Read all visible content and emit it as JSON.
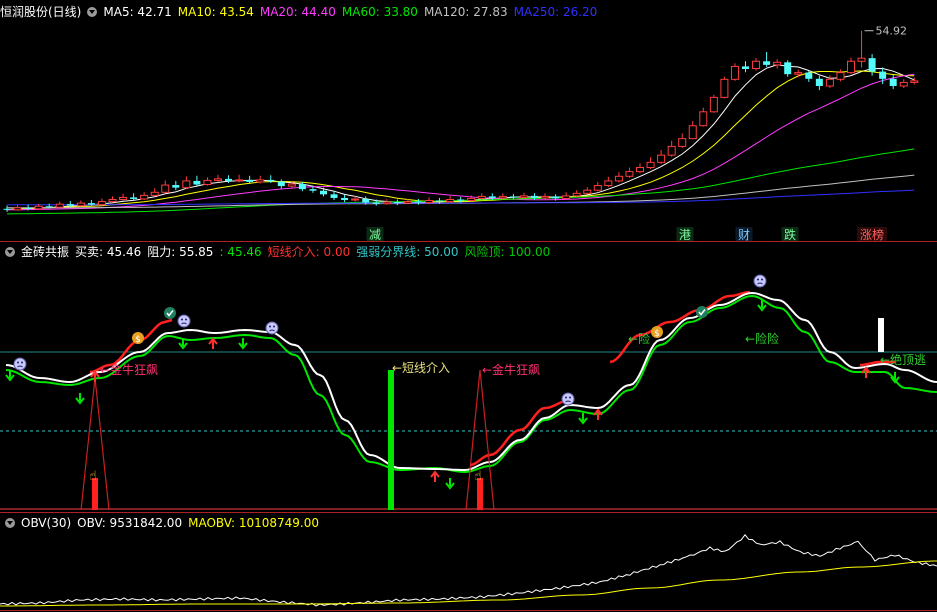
{
  "colors": {
    "bg": "#000000",
    "separator": "#b02020",
    "up_candle": "#ff3c3c",
    "down_candle": "#54fcfc",
    "ma5": "#ffffff",
    "ma10": "#ffff00",
    "ma20": "#ff3cff",
    "ma60": "#00e600",
    "ma120": "#c0c0c0",
    "ma250": "#3030ff",
    "obv": "#ffffff",
    "maobv": "#ffff00"
  },
  "panel1": {
    "title": "恒润股份(日线)",
    "legend": [
      {
        "label": "MA5: 42.71",
        "color": "#ffffff"
      },
      {
        "label": "MA10: 43.54",
        "color": "#ffff00"
      },
      {
        "label": "MA20: 44.40",
        "color": "#ff3cff"
      },
      {
        "label": "MA60: 33.80",
        "color": "#00e600"
      },
      {
        "label": "MA120: 27.83",
        "color": "#c0c0c0"
      },
      {
        "label": "MA250: 26.20",
        "color": "#3030ff"
      }
    ],
    "high_label": "54.92",
    "signal_tags": [
      {
        "text": "减",
        "color": "#7cfc9c"
      },
      {
        "text": "港",
        "color": "#7cfc9c"
      },
      {
        "text": "财",
        "color": "#7cc8ff"
      },
      {
        "text": "跌",
        "color": "#7cfc9c"
      },
      {
        "text": "涨榜",
        "color": "#ff6060"
      }
    ]
  },
  "panel2": {
    "title": "金砖共振",
    "legend": [
      {
        "label": "买卖: 45.46",
        "color": "#ffffff"
      },
      {
        "label": "阻力: 55.85",
        "color": "#ffffff"
      },
      {
        "label": ": 45.46",
        "color": "#00e600"
      },
      {
        "label": "短线介入: 0.00",
        "color": "#ff3030"
      },
      {
        "label": "强弱分界线: 50.00",
        "color": "#30c8c8"
      },
      {
        "label": "风险顶: 100.00",
        "color": "#00c800"
      }
    ],
    "annotations": {
      "bull_left": "←金牛狂飙",
      "short_entry": "←短线介入",
      "bull_right": "←金牛狂飙",
      "risk1": "←险",
      "risk2": "←险险",
      "top_escape": "←绝顶逃"
    }
  },
  "panel3": {
    "title": "OBV(30)",
    "legend": [
      {
        "label": "OBV: 9531842.00",
        "color": "#ffffff"
      },
      {
        "label": "MAOBV: 10108749.00",
        "color": "#ffff00"
      }
    ]
  },
  "chart_data": [
    {
      "type": "candlestick",
      "title": "恒润股份(日线)",
      "annotations": [
        "54.92"
      ],
      "series": [
        {
          "name": "MA5",
          "last": 42.71
        },
        {
          "name": "MA10",
          "last": 43.54
        },
        {
          "name": "MA20",
          "last": 44.4
        },
        {
          "name": "MA60",
          "last": 33.8
        },
        {
          "name": "MA120",
          "last": 27.83
        },
        {
          "name": "MA250",
          "last": 26.2
        }
      ],
      "candles": [
        [
          20.4,
          20.2,
          21.0,
          19.8
        ],
        [
          20.2,
          20.6,
          21.1,
          20.0
        ],
        [
          20.6,
          20.5,
          21.2,
          20.1
        ],
        [
          20.4,
          20.9,
          21.3,
          20.2
        ],
        [
          20.9,
          20.8,
          21.4,
          20.5
        ],
        [
          20.7,
          21.3,
          21.8,
          20.5
        ],
        [
          21.3,
          21.0,
          21.9,
          20.8
        ],
        [
          21.0,
          21.5,
          22.0,
          20.8
        ],
        [
          21.5,
          21.2,
          22.1,
          21.0
        ],
        [
          21.2,
          21.8,
          22.4,
          21.0
        ],
        [
          21.8,
          22.2,
          22.8,
          21.6
        ],
        [
          22.2,
          22.6,
          23.3,
          22.0
        ],
        [
          22.6,
          22.3,
          23.4,
          22.0
        ],
        [
          22.3,
          23.0,
          23.6,
          22.1
        ],
        [
          23.0,
          23.6,
          24.4,
          22.8
        ],
        [
          23.6,
          25.0,
          25.9,
          23.4
        ],
        [
          25.0,
          24.5,
          25.8,
          24.0
        ],
        [
          24.5,
          25.8,
          26.7,
          24.3
        ],
        [
          25.8,
          25.1,
          26.8,
          24.8
        ],
        [
          25.1,
          25.9,
          26.5,
          24.9
        ],
        [
          25.9,
          26.2,
          27.0,
          25.5
        ],
        [
          26.2,
          25.8,
          26.9,
          25.4
        ],
        [
          25.9,
          26.0,
          27.0,
          25.5
        ],
        [
          26.0,
          25.6,
          26.8,
          25.2
        ],
        [
          25.6,
          26.0,
          26.8,
          25.3
        ],
        [
          26.0,
          25.7,
          26.9,
          25.4
        ],
        [
          25.7,
          24.8,
          26.1,
          24.3
        ],
        [
          24.8,
          25.2,
          25.8,
          24.5
        ],
        [
          25.2,
          24.2,
          25.6,
          23.8
        ],
        [
          24.2,
          23.9,
          24.8,
          23.5
        ],
        [
          23.9,
          23.2,
          24.5,
          22.8
        ],
        [
          23.2,
          22.5,
          23.9,
          22.1
        ],
        [
          22.5,
          22.1,
          23.1,
          21.7
        ],
        [
          22.1,
          22.3,
          23.0,
          21.8
        ],
        [
          22.3,
          21.6,
          22.8,
          21.2
        ],
        [
          21.6,
          21.4,
          22.2,
          21.0
        ],
        [
          21.4,
          21.7,
          22.3,
          21.2
        ],
        [
          21.7,
          21.5,
          22.2,
          21.1
        ],
        [
          21.5,
          21.8,
          22.3,
          21.3
        ],
        [
          21.8,
          21.6,
          22.3,
          21.2
        ],
        [
          21.6,
          22.0,
          22.6,
          21.3
        ],
        [
          22.0,
          21.8,
          22.5,
          21.4
        ],
        [
          21.8,
          22.2,
          22.9,
          21.6
        ],
        [
          22.2,
          22.0,
          22.7,
          21.6
        ],
        [
          22.0,
          22.4,
          23.0,
          21.8
        ],
        [
          22.4,
          22.8,
          23.4,
          22.2
        ],
        [
          22.8,
          22.5,
          23.4,
          22.1
        ],
        [
          22.5,
          22.8,
          23.4,
          22.2
        ],
        [
          22.8,
          22.6,
          23.3,
          22.2
        ],
        [
          22.6,
          22.9,
          23.5,
          22.4
        ],
        [
          22.9,
          22.5,
          23.4,
          22.1
        ],
        [
          22.5,
          22.8,
          23.4,
          22.2
        ],
        [
          22.8,
          22.4,
          23.2,
          22.0
        ],
        [
          22.4,
          22.9,
          23.6,
          22.2
        ],
        [
          22.9,
          23.4,
          24.0,
          22.7
        ],
        [
          23.4,
          24.0,
          24.6,
          23.2
        ],
        [
          24.0,
          24.9,
          25.6,
          23.8
        ],
        [
          24.9,
          25.8,
          26.6,
          24.6
        ],
        [
          25.8,
          26.7,
          27.5,
          25.5
        ],
        [
          26.7,
          27.6,
          28.4,
          26.4
        ],
        [
          27.6,
          28.4,
          29.2,
          27.3
        ],
        [
          28.4,
          29.4,
          30.4,
          28.1
        ],
        [
          29.4,
          30.8,
          31.8,
          29.1
        ],
        [
          30.8,
          32.5,
          33.6,
          30.5
        ],
        [
          32.5,
          34.0,
          35.0,
          32.2
        ],
        [
          34.0,
          36.5,
          37.4,
          33.9
        ],
        [
          36.5,
          39.2,
          40.0,
          36.3
        ],
        [
          39.2,
          42.0,
          42.5,
          39.0
        ],
        [
          42.0,
          45.5,
          46.0,
          41.8
        ],
        [
          45.5,
          48.0,
          48.6,
          45.2
        ],
        [
          48.0,
          47.5,
          49.0,
          46.9
        ],
        [
          47.6,
          49.0,
          49.6,
          47.2
        ],
        [
          49.0,
          48.3,
          50.8,
          47.9
        ],
        [
          48.3,
          48.8,
          49.4,
          47.6
        ],
        [
          48.8,
          46.5,
          49.2,
          46.0
        ],
        [
          46.5,
          46.8,
          47.4,
          45.9
        ],
        [
          46.8,
          45.6,
          47.2,
          45.0
        ],
        [
          45.6,
          44.2,
          46.2,
          43.4
        ],
        [
          44.2,
          45.5,
          46.3,
          43.8
        ],
        [
          45.5,
          46.8,
          47.4,
          45.1
        ],
        [
          46.8,
          49.0,
          49.7,
          46.5
        ],
        [
          49.0,
          49.6,
          54.92,
          47.8
        ],
        [
          49.6,
          47.0,
          50.4,
          46.2
        ],
        [
          47.0,
          45.6,
          47.8,
          44.6
        ],
        [
          45.6,
          44.2,
          46.4,
          43.6
        ],
        [
          44.2,
          44.9,
          45.5,
          43.8
        ],
        [
          44.9,
          45.2,
          45.8,
          44.5
        ]
      ]
    },
    {
      "type": "line",
      "title": "金砖共振",
      "series": [
        {
          "name": "买卖",
          "last": 45.46
        },
        {
          "name": "阻力",
          "last": 55.85
        },
        {
          "name": "短线介入",
          "last": 0.0
        },
        {
          "name": "强弱分界线",
          "last": 50.0
        },
        {
          "name": "风险顶",
          "last": 100.0
        }
      ]
    },
    {
      "type": "line",
      "title": "OBV(30)",
      "series": [
        {
          "name": "OBV",
          "last": 9531842.0
        },
        {
          "name": "MAOBV",
          "last": 10108749.0
        }
      ]
    }
  ]
}
